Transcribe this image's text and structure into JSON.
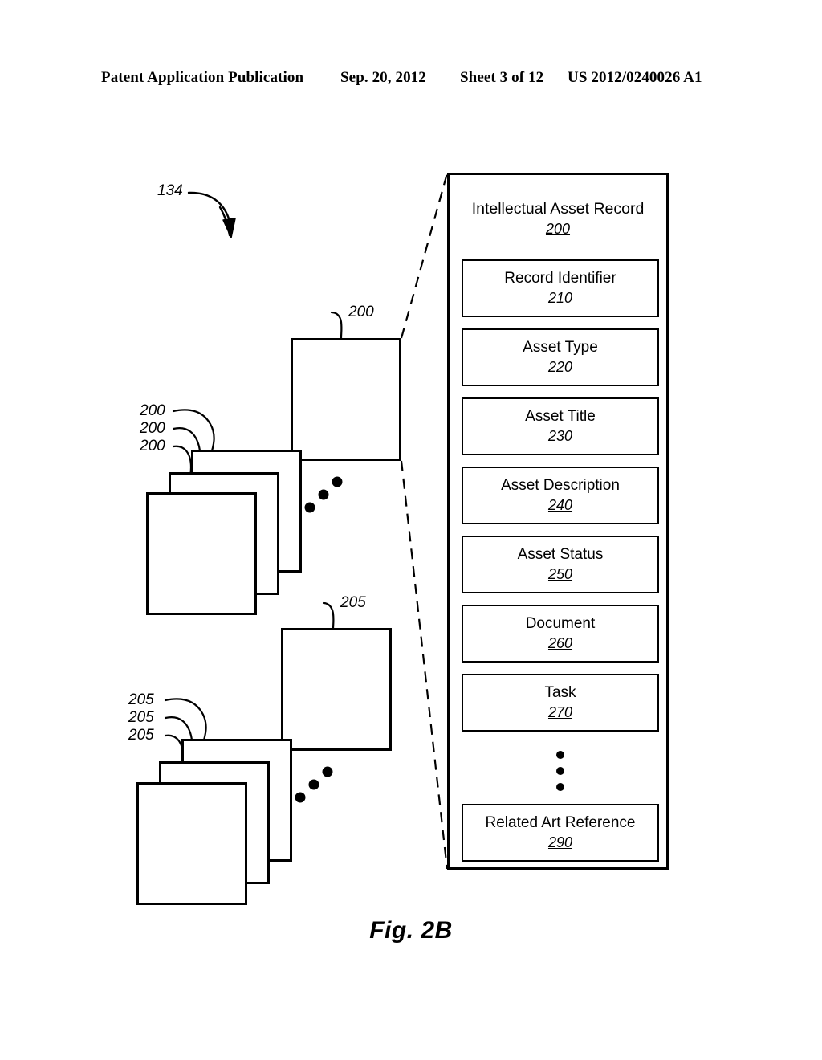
{
  "header": {
    "publication": "Patent Application Publication",
    "date": "Sep. 20, 2012",
    "sheet": "Sheet 3 of 12",
    "patent_number": "US 2012/0240026 A1"
  },
  "figure": {
    "caption": "Fig. 2B",
    "system_ref": "134"
  },
  "panel": {
    "title": "Intellectual Asset Record",
    "ref": "200",
    "fields": [
      {
        "label": "Record Identifier",
        "ref": "210"
      },
      {
        "label": "Asset Type",
        "ref": "220"
      },
      {
        "label": "Asset Title",
        "ref": "230"
      },
      {
        "label": "Asset Description",
        "ref": "240"
      },
      {
        "label": "Asset Status",
        "ref": "250"
      },
      {
        "label": "Document",
        "ref": "260"
      },
      {
        "label": "Task",
        "ref": "270"
      }
    ],
    "tail_field": {
      "label": "Related Art Reference",
      "ref": "290"
    }
  },
  "stacks": {
    "record_stack": {
      "front_ref": "200",
      "labels": [
        "200",
        "200",
        "200"
      ]
    },
    "document_stack": {
      "front_ref": "205",
      "labels": [
        "205",
        "205",
        "205"
      ]
    }
  }
}
